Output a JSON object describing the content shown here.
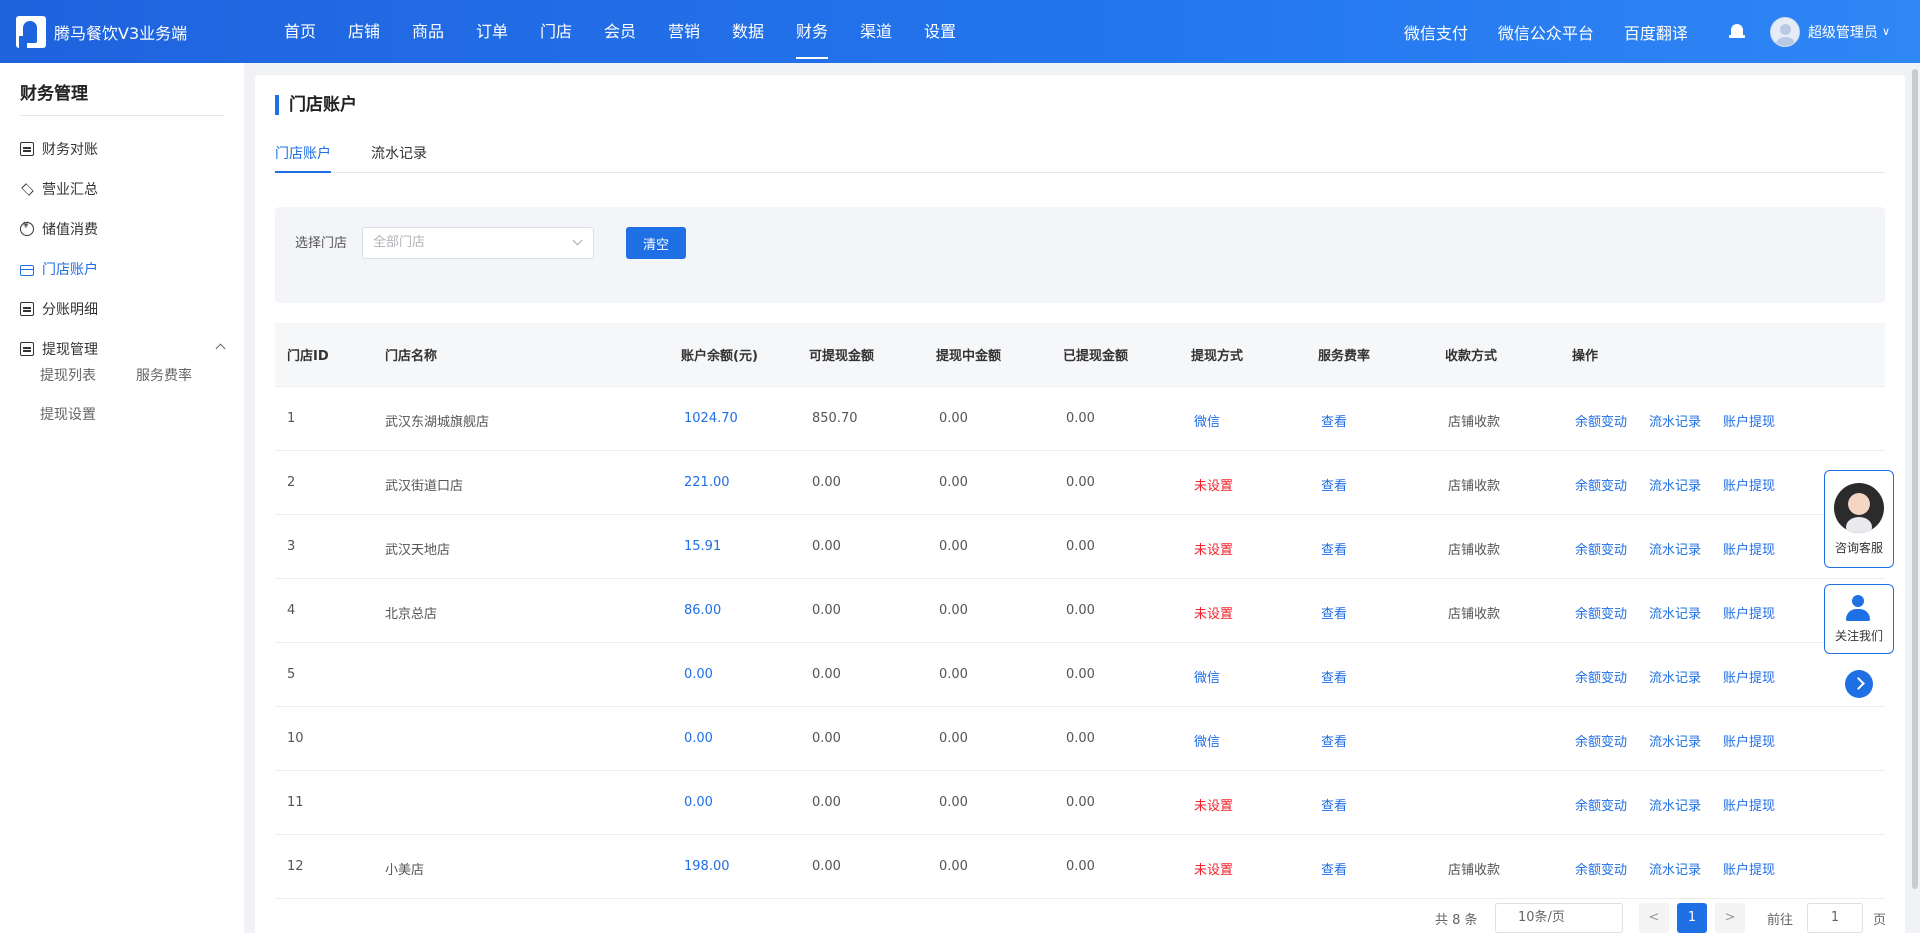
{
  "app": {
    "title": "腾马餐饮V3业务端"
  },
  "nav": {
    "items": [
      {
        "label": "首页"
      },
      {
        "label": "店铺"
      },
      {
        "label": "商品"
      },
      {
        "label": "订单"
      },
      {
        "label": "门店"
      },
      {
        "label": "会员"
      },
      {
        "label": "营销"
      },
      {
        "label": "数据"
      },
      {
        "label": "财务",
        "active": true
      },
      {
        "label": "渠道"
      },
      {
        "label": "设置"
      }
    ]
  },
  "top_links": {
    "wechat_pay": "微信支付",
    "wechat_mp": "微信公众平台",
    "baidu_translate": "百度翻译"
  },
  "user": {
    "name": "超级管理员"
  },
  "sidebar": {
    "title": "财务管理",
    "items": [
      {
        "label": "财务对账",
        "icon": "database-icon"
      },
      {
        "label": "营业汇总",
        "icon": "layers-icon"
      },
      {
        "label": "储值消费",
        "icon": "coin-icon"
      },
      {
        "label": "门店账户",
        "icon": "card-icon",
        "active": true
      },
      {
        "label": "分账明细",
        "icon": "database-icon"
      },
      {
        "label": "提现管理",
        "icon": "database-icon",
        "expanded": true
      }
    ],
    "subitems": [
      {
        "label": "提现列表"
      },
      {
        "label": "服务费率"
      },
      {
        "label": "提现设置"
      }
    ]
  },
  "page": {
    "title": "门店账户",
    "tabs": [
      {
        "label": "门店账户",
        "active": true
      },
      {
        "label": "流水记录"
      }
    ]
  },
  "filter": {
    "label": "选择门店",
    "placeholder": "全部门店",
    "clear_label": "清空"
  },
  "table": {
    "headers": [
      "门店ID",
      "门店名称",
      "账户余额(元)",
      "可提现金额",
      "提现中金额",
      "已提现金额",
      "提现方式",
      "服务费率",
      "收款方式",
      "操作"
    ],
    "actions": [
      "余额变动",
      "流水记录",
      "账户提现"
    ],
    "rows": [
      {
        "id": "1",
        "name": "武汉东湖城旗舰店",
        "balance": "1024.70",
        "withdrawable": "850.70",
        "pending": "0.00",
        "withdrawn": "0.00",
        "method": "微信",
        "method_set": true,
        "fee": "查看",
        "collect": "店铺收款"
      },
      {
        "id": "2",
        "name": "武汉街道口店",
        "balance": "221.00",
        "withdrawable": "0.00",
        "pending": "0.00",
        "withdrawn": "0.00",
        "method": "未设置",
        "method_set": false,
        "fee": "查看",
        "collect": "店铺收款"
      },
      {
        "id": "3",
        "name": "武汉天地店",
        "balance": "15.91",
        "withdrawable": "0.00",
        "pending": "0.00",
        "withdrawn": "0.00",
        "method": "未设置",
        "method_set": false,
        "fee": "查看",
        "collect": "店铺收款"
      },
      {
        "id": "4",
        "name": "北京总店",
        "balance": "86.00",
        "withdrawable": "0.00",
        "pending": "0.00",
        "withdrawn": "0.00",
        "method": "未设置",
        "method_set": false,
        "fee": "查看",
        "collect": "店铺收款"
      },
      {
        "id": "5",
        "name": "",
        "balance": "0.00",
        "withdrawable": "0.00",
        "pending": "0.00",
        "withdrawn": "0.00",
        "method": "微信",
        "method_set": true,
        "fee": "查看",
        "collect": ""
      },
      {
        "id": "10",
        "name": "",
        "balance": "0.00",
        "withdrawable": "0.00",
        "pending": "0.00",
        "withdrawn": "0.00",
        "method": "微信",
        "method_set": true,
        "fee": "查看",
        "collect": ""
      },
      {
        "id": "11",
        "name": "",
        "balance": "0.00",
        "withdrawable": "0.00",
        "pending": "0.00",
        "withdrawn": "0.00",
        "method": "未设置",
        "method_set": false,
        "fee": "查看",
        "collect": ""
      },
      {
        "id": "12",
        "name": "小美店",
        "balance": "198.00",
        "withdrawable": "0.00",
        "pending": "0.00",
        "withdrawn": "0.00",
        "method": "未设置",
        "method_set": false,
        "fee": "查看",
        "collect": "店铺收款"
      }
    ]
  },
  "pagination": {
    "total": "共 8 条",
    "page_size": "10条/页",
    "prev": "<",
    "current": "1",
    "next": ">",
    "goto_label": "前往",
    "goto_value": "1",
    "goto_unit": "页"
  },
  "float": {
    "service_label": "咨询客服",
    "follow_label": "关注我们"
  },
  "colors": {
    "primary": "#1f6fe5",
    "danger": "#f5222d",
    "topbar": "#2476ee"
  }
}
